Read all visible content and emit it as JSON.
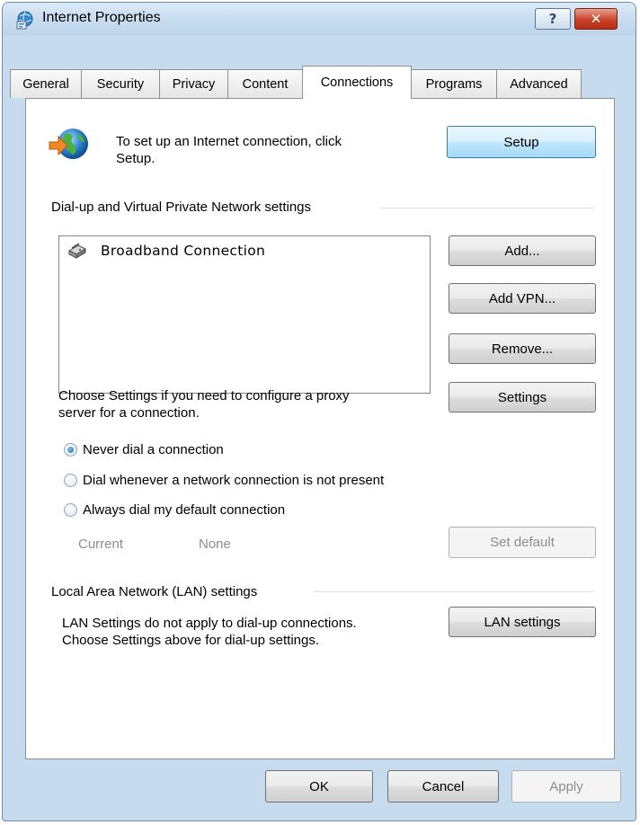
{
  "window": {
    "title": "Internet Properties",
    "help_label": "?",
    "close_label": "✕"
  },
  "tabs": [
    {
      "label": "General",
      "active": false
    },
    {
      "label": "Security",
      "active": false
    },
    {
      "label": "Privacy",
      "active": false
    },
    {
      "label": "Content",
      "active": false
    },
    {
      "label": "Connections",
      "active": true
    },
    {
      "label": "Programs",
      "active": false
    },
    {
      "label": "Advanced",
      "active": false
    }
  ],
  "setup": {
    "text_line1": "To set up an Internet connection, click",
    "text_line2": "Setup.",
    "button_label": "Setup",
    "icon": "internet-globe-icon"
  },
  "dialup": {
    "group_label": "Dial-up and Virtual Private Network settings",
    "connections": [
      {
        "name": "Broadband Connection",
        "icon": "broadband-modem-icon"
      }
    ],
    "add_label": "Add...",
    "add_vpn_label": "Add VPN...",
    "remove_label": "Remove...",
    "proxy_text_line1": "Choose Settings if you need to configure a proxy",
    "proxy_text_line2": "server for a connection.",
    "settings_label": "Settings",
    "options": [
      {
        "label": "Never dial a connection",
        "checked": true
      },
      {
        "label": "Dial whenever a network connection is not present",
        "checked": false
      },
      {
        "label": "Always dial my default connection",
        "checked": false
      }
    ],
    "current_label": "Current",
    "current_value": "None",
    "set_default_label": "Set default"
  },
  "lan": {
    "group_label": "Local Area Network (LAN) settings",
    "text_line1": "LAN Settings do not apply to dial-up connections.",
    "text_line2": "Choose Settings above for dial-up settings.",
    "button_label": "LAN settings"
  },
  "footer": {
    "ok_label": "OK",
    "cancel_label": "Cancel",
    "apply_label": "Apply"
  },
  "colors": {
    "frame": "#c7dbee",
    "focus_button": "#bee6fd",
    "close_button": "#c7442a"
  }
}
